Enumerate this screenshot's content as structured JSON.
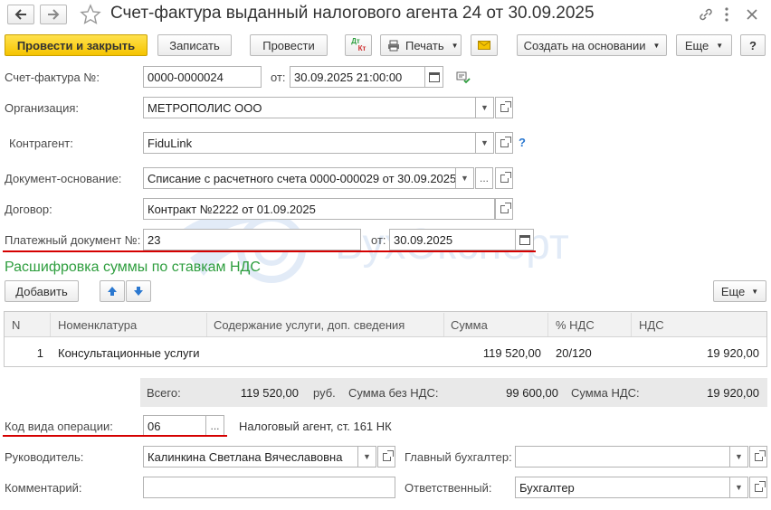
{
  "header": {
    "title": "Счет-фактура выданный налогового агента 24 от 30.09.2025"
  },
  "toolbar": {
    "post_close": "Провести и закрыть",
    "save": "Записать",
    "post": "Провести",
    "dtkt_top": "Дт",
    "dtkt_bottom": "Кт",
    "print": "Печать",
    "create_based": "Создать на основании",
    "more": "Еще",
    "help": "?"
  },
  "form": {
    "invoice_label": "Счет-фактура №:",
    "invoice_number": "0000-0000024",
    "from_label": "от:",
    "invoice_date": "30.09.2025 21:00:00",
    "org_label": "Организация:",
    "org_value": "МЕТРОПОЛИС ООО",
    "counterparty_label": "Контрагент:",
    "counterparty_value": "FiduLink",
    "help_mark": "?",
    "basis_label": "Документ-основание:",
    "basis_value": "Списание с расчетного счета 0000-000029 от 30.09.2025",
    "basis_more": "...",
    "contract_label": "Договор:",
    "contract_value": "Контракт №2222 от 01.09.2025",
    "payment_doc_label": "Платежный документ №:",
    "payment_doc_number": "23",
    "payment_from_label": "от:",
    "payment_doc_date": "30.09.2025"
  },
  "section": {
    "title": "Расшифровка суммы по ставкам НДС",
    "add": "Добавить",
    "more": "Еще"
  },
  "table": {
    "headers": [
      "N",
      "Номенклатура",
      "Содержание услуги, доп. сведения",
      "Сумма",
      "% НДС",
      "НДС"
    ],
    "rows": [
      {
        "n": "1",
        "item": "Консультационные услуги",
        "content": "",
        "sum": "119 520,00",
        "rate": "20/120",
        "vat": "19 920,00"
      }
    ]
  },
  "totals": {
    "total_label": "Всего:",
    "total_value": "119 520,00",
    "currency": "руб.",
    "without_vat_label": "Сумма без НДС:",
    "without_vat_value": "99 600,00",
    "vat_label": "Сумма НДС:",
    "vat_value": "19 920,00"
  },
  "footer": {
    "op_code_label": "Код вида операции:",
    "op_code_value": "06",
    "op_code_more": "...",
    "op_code_desc": "Налоговый агент, ст. 161 НК",
    "head_label": "Руководитель:",
    "head_value": "Калинкина Светлана Вячеславовна",
    "chief_acc_label": "Главный бухгалтер:",
    "chief_acc_value": "",
    "comment_label": "Комментарий:",
    "comment_value": "",
    "responsible_label": "Ответственный:",
    "responsible_value": "Бухгалтер"
  },
  "watermark": {
    "text": "БухЭксперт"
  },
  "colors": {
    "primary_button": "#f5c400",
    "section_title": "#2e9e3e",
    "underline": "#d50000",
    "totals_bg": "#e9e9e9",
    "arrow_blue": "#2b78d0"
  },
  "icons": [
    "back-arrow-icon",
    "forward-arrow-icon",
    "star-icon",
    "link-icon",
    "kebab-menu-icon",
    "close-icon",
    "printer-icon",
    "envelope-icon",
    "calendar-icon",
    "document-check-icon",
    "arrow-up-icon",
    "arrow-down-icon"
  ]
}
